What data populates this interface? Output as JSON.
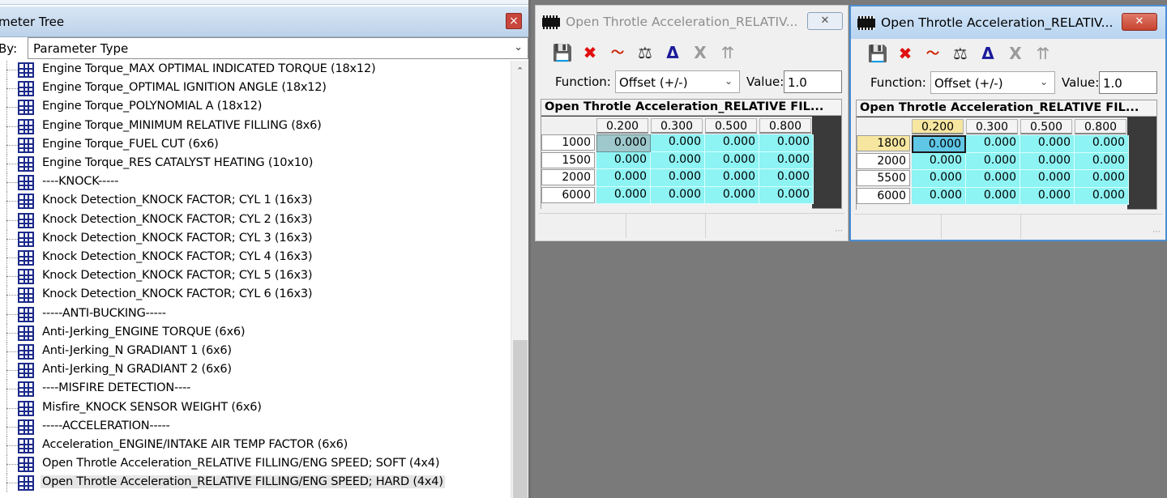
{
  "tree": {
    "title": "meter Tree",
    "sort_label": "By:",
    "sort_value": "Parameter Type",
    "items": [
      {
        "label": "Engine Torque_MAX OPTIMAL INDICATED TORQUE (18x12)"
      },
      {
        "label": "Engine Torque_OPTIMAL IGNITION ANGLE (18x12)"
      },
      {
        "label": "Engine Torque_POLYNOMIAL A (18x12)"
      },
      {
        "label": "Engine Torque_MINIMUM RELATIVE FILLING (8x6)"
      },
      {
        "label": "Engine Torque_FUEL CUT (6x6)"
      },
      {
        "label": "Engine Torque_RES CATALYST HEATING (10x10)"
      },
      {
        "label": "----KNOCK-----"
      },
      {
        "label": "Knock Detection_KNOCK FACTOR; CYL 1 (16x3)"
      },
      {
        "label": "Knock Detection_KNOCK FACTOR; CYL 2 (16x3)"
      },
      {
        "label": "Knock Detection_KNOCK FACTOR; CYL 3 (16x3)"
      },
      {
        "label": "Knock Detection_KNOCK FACTOR; CYL 4 (16x3)"
      },
      {
        "label": "Knock Detection_KNOCK FACTOR; CYL 5 (16x3)"
      },
      {
        "label": "Knock Detection_KNOCK FACTOR; CYL 6 (16x3)"
      },
      {
        "label": "-----ANTI-BUCKING-----"
      },
      {
        "label": "Anti-Jerking_ENGINE TORQUE (6x6)"
      },
      {
        "label": "Anti-Jerking_N GRADIANT 1 (6x6)"
      },
      {
        "label": "Anti-Jerking_N GRADIANT 2 (6x6)"
      },
      {
        "label": "----MISFIRE DETECTION----"
      },
      {
        "label": "Misfire_KNOCK SENSOR WEIGHT (6x6)"
      },
      {
        "label": "-----ACCELERATION-----"
      },
      {
        "label": "Acceleration_ENGINE/INTAKE AIR TEMP FACTOR (6x6)"
      },
      {
        "label": "Open Throtle Acceleration_RELATIVE FILLING/ENG SPEED; SOFT (4x4)"
      },
      {
        "label": "Open Throtle Acceleration_RELATIVE FILLING/ENG SPEED; HARD (4x4)"
      }
    ],
    "selected_index": 22,
    "close_glyph": "×"
  },
  "window1": {
    "title": "Open Throtle Acceleration_RELATIV...",
    "close_glyph": "✕",
    "function_label": "Function:",
    "function_value": "Offset (+/-)",
    "value_label": "Value:",
    "value": "1.0",
    "map_title": "Open Throtle Acceleration_RELATIVE FIL...",
    "col_headers": [
      "0.200",
      "0.300",
      "0.500",
      "0.800"
    ],
    "row_headers": [
      "1000",
      "1500",
      "2000",
      "6000"
    ],
    "cells": [
      [
        "0.000",
        "0.000",
        "0.000",
        "0.000"
      ],
      [
        "0.000",
        "0.000",
        "0.000",
        "0.000"
      ],
      [
        "0.000",
        "0.000",
        "0.000",
        "0.000"
      ],
      [
        "0.000",
        "0.000",
        "0.000",
        "0.000"
      ]
    ]
  },
  "window2": {
    "title": "Open Throtle Acceleration_RELATIV...",
    "close_glyph": "✕",
    "function_label": "Function:",
    "function_value": "Offset (+/-)",
    "value_label": "Value:",
    "value": "1.0",
    "map_title": "Open Throtle Acceleration_RELATIVE FIL...",
    "col_headers": [
      "0.200",
      "0.300",
      "0.500",
      "0.800"
    ],
    "row_headers": [
      "1800",
      "2000",
      "5500",
      "6000"
    ],
    "cells": [
      [
        "0.000",
        "0.000",
        "0.000",
        "0.000"
      ],
      [
        "0.000",
        "0.000",
        "0.000",
        "0.000"
      ],
      [
        "0.000",
        "0.000",
        "0.000",
        "0.000"
      ],
      [
        "0.000",
        "0.000",
        "0.000",
        "0.000"
      ]
    ]
  },
  "toolbar_icons": [
    "save-icon",
    "delete-icon",
    "graph-icon",
    "balance-icon",
    "delta-icon",
    "x-axis-icon",
    "y-axis-icon"
  ],
  "colors": {
    "cell_value": "#8ef3f3",
    "active_header": "#f6e6a0",
    "selected_cell": "#5fc6e6",
    "tree_icon": "#1c2a8a"
  }
}
